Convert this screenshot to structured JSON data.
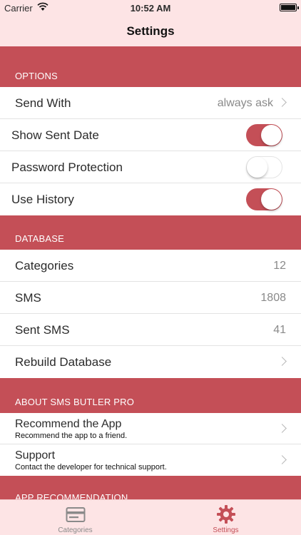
{
  "status": {
    "carrier": "Carrier",
    "time": "10:52 AM"
  },
  "nav": {
    "title": "Settings"
  },
  "options": {
    "header": "OPTIONS",
    "send_with_label": "Send With",
    "send_with_value": "always ask",
    "show_sent_date_label": "Show Sent Date",
    "show_sent_date_on": true,
    "password_label": "Password Protection",
    "password_on": false,
    "use_history_label": "Use History",
    "use_history_on": true
  },
  "database": {
    "header": "DATABASE",
    "categories_label": "Categories",
    "categories_value": "12",
    "sms_label": "SMS",
    "sms_value": "1808",
    "sent_sms_label": "Sent SMS",
    "sent_sms_value": "41",
    "rebuild_label": "Rebuild Database"
  },
  "about": {
    "header": "ABOUT SMS BUTLER PRO",
    "recommend_title": "Recommend the App",
    "recommend_sub": "Recommend the app to a friend.",
    "support_title": "Support",
    "support_sub": "Contact the developer for technical support."
  },
  "app_rec": {
    "header": "APP RECOMMENDATION"
  },
  "tabs": {
    "categories_label": "Categories",
    "settings_label": "Settings"
  },
  "colors": {
    "accent": "#c44f57",
    "bar_bg": "#fde4e5",
    "inactive": "#8a8a8a"
  },
  "icons": {
    "categories_tab": "card-icon",
    "settings_tab": "gear-icon"
  }
}
